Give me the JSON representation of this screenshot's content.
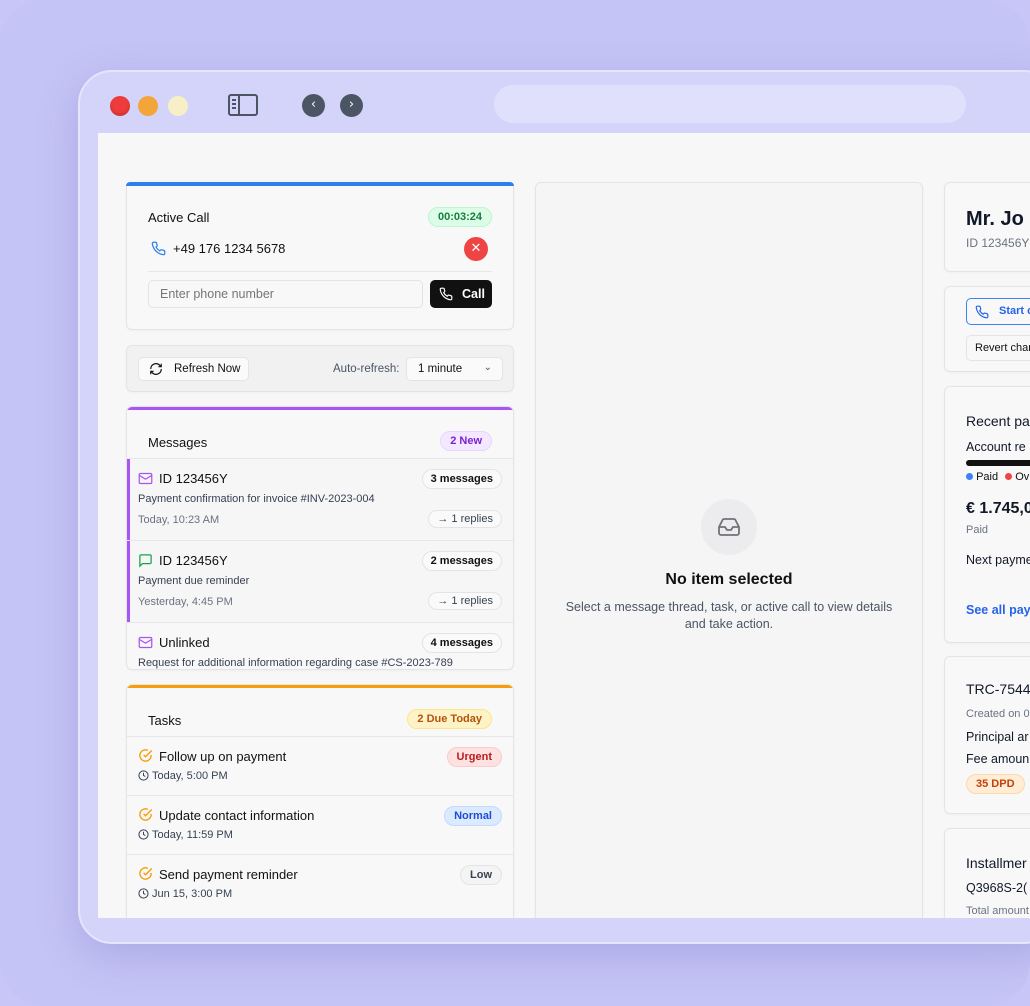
{
  "active_call": {
    "title": "Active Call",
    "timer": "00:03:24",
    "phone_number": "+49 176 1234 5678",
    "input_placeholder": "Enter phone number",
    "call_label": "Call"
  },
  "refresh": {
    "button_label": "Refresh Now",
    "auto_label": "Auto-refresh:",
    "interval": "1 minute"
  },
  "messages": {
    "title": "Messages",
    "new_badge": "2 New",
    "items": [
      {
        "title": "ID 123456Y",
        "count": "3 messages",
        "desc": "Payment confirmation for invoice #INV-2023-004",
        "time": "Today, 10:23 AM",
        "replies": "→ 1 replies"
      },
      {
        "title": "ID 123456Y",
        "count": "2 messages",
        "desc": "Payment due reminder",
        "time": "Yesterday, 4:45 PM",
        "replies": "→ 1 replies"
      },
      {
        "title": "Unlinked",
        "count": "4 messages",
        "desc": "Request for additional information regarding case #CS-2023-789"
      }
    ]
  },
  "tasks": {
    "title": "Tasks",
    "due_badge": "2 Due Today",
    "items": [
      {
        "title": "Follow up on payment",
        "priority": "Urgent",
        "time": "Today, 5:00 PM"
      },
      {
        "title": "Update contact information",
        "priority": "Normal",
        "time": "Today, 11:59 PM"
      },
      {
        "title": "Send payment reminder",
        "priority": "Low",
        "time": "Jun 15, 3:00 PM"
      }
    ]
  },
  "detail": {
    "empty_title": "No item selected",
    "empty_desc": "Select a message thread, task, or active call to view details and take action."
  },
  "customer": {
    "name": "Mr. Jo",
    "id": "ID 123456Y",
    "start_label": "Start c",
    "revert_label": "Revert char",
    "recent_title": "Recent pa",
    "account_label": "Account re",
    "legend_paid": "Paid",
    "legend_overdue": "Ov",
    "amount": "€ 1.745,0",
    "paid_label": "Paid",
    "next_payment": "Next payme",
    "see_all": "See all pay",
    "case_id": "TRC-7544",
    "created": "Created on 0",
    "principal": "Principal ar",
    "fee": "Fee amoun",
    "dpd": "35 DPD",
    "installments_title": "Installmer",
    "installment_id": "Q3968S-2(",
    "total_amount": "Total amount"
  }
}
